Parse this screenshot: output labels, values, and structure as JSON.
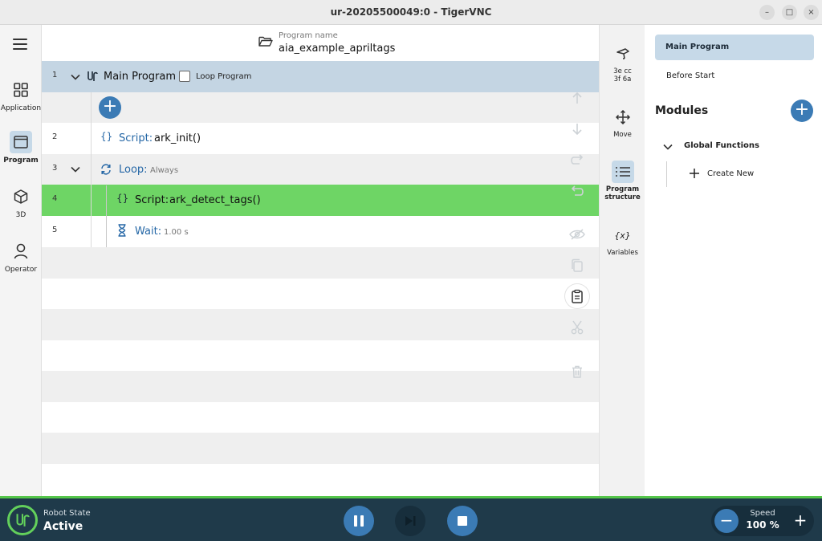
{
  "window": {
    "title": "ur-20205500049:0 - TigerVNC",
    "minimize": "–",
    "maximize": "□",
    "close": "×"
  },
  "nav": {
    "items": [
      {
        "label": "Application",
        "icon": "grid-icon"
      },
      {
        "label": "Program",
        "icon": "program-icon",
        "active": true
      },
      {
        "label": "3D",
        "icon": "cube-icon"
      },
      {
        "label": "Operator",
        "icon": "person-icon"
      }
    ]
  },
  "program": {
    "name_label": "Program name",
    "name": "aia_example_apriltags",
    "rows": [
      {
        "num": "1",
        "text": "Main Program",
        "loop_label": "Loop Program"
      },
      {
        "num": "2",
        "keyword": "Script:",
        "value": "ark_init()"
      },
      {
        "num": "3",
        "keyword": "Loop:",
        "sub": "Always"
      },
      {
        "num": "4",
        "keyword": "Script:",
        "value": "ark_detect_tags()"
      },
      {
        "num": "5",
        "keyword": "Wait:",
        "sub": "1.00 s"
      }
    ],
    "add_symbol": "+"
  },
  "rail": {
    "items": [
      {
        "label": "3e cc\n3f 6a",
        "line1": "3e cc",
        "line2": "3f 6a",
        "icon": "robot-arm-icon"
      },
      {
        "label": "Move",
        "icon": "move-icon"
      },
      {
        "line1": "Program",
        "line2": "structure",
        "icon": "list-icon",
        "active": true
      },
      {
        "label": "Variables",
        "icon": "variables-icon",
        "glyph": "{x}"
      }
    ]
  },
  "panel": {
    "main_program": "Main Program",
    "before_start": "Before Start",
    "modules": "Modules",
    "global_functions": "Global Functions",
    "create_new": "Create New"
  },
  "bottom": {
    "robot_state_label": "Robot State",
    "robot_state": "Active",
    "speed_label": "Speed",
    "speed_value": "100 %",
    "speed_minus": "−",
    "speed_plus": "+"
  },
  "colors": {
    "accent": "#3b7bb5",
    "selected_row": "#6ed565",
    "main_row": "#c4d5e3",
    "bottom_bar": "#1f3a4a",
    "state_green": "#63d05b"
  }
}
